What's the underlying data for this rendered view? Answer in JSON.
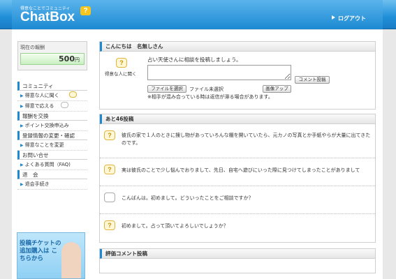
{
  "header": {
    "tagline": "得意なことでコミュニティ",
    "logo": "ChatBox",
    "logo_mark": "?",
    "logout": "ログアウト"
  },
  "sidebar": {
    "reward_title": "現在の報酬",
    "reward_value": "500",
    "reward_unit": "円",
    "sections": [
      {
        "title": "コミュニティ",
        "items": [
          "得意な人に聞く",
          "得意で応える"
        ]
      },
      {
        "title": "報酬を交換",
        "items": [
          "ポイント交換申込み"
        ]
      },
      {
        "title": "登録情報の変更・確認",
        "items": [
          "得意なことを変更"
        ]
      },
      {
        "title": "お問い合せ",
        "items": [
          "よくある質問（FAQ)"
        ]
      },
      {
        "title": "退　会",
        "items": [
          "退会手続き"
        ]
      }
    ],
    "banner_text": "投稿チケットの追加購入は こちらから"
  },
  "greeting_panel": {
    "title": "こんにちは　名無しさん",
    "icon_label": "得意な人に聞く",
    "intro": "占い天使さんに相談を投稿しましょう。",
    "textarea_value": "",
    "comment_button": "コメント投稿",
    "file_button": "ファイルを選択",
    "no_file": "ファイル未選択",
    "image_up_button": "画像アップ",
    "note": "※相手が混み合っている時は返信が滞る場合があります。"
  },
  "posts_panel": {
    "title": "あと46投稿",
    "posts": [
      {
        "type": "question",
        "text": "彼氏の家で１人のときに捜し物があっていろんな棚を開いていたら、元カノの写真とか手紙やらが大量に出てきたのです。"
      },
      {
        "type": "question",
        "text": "実は彼氏のことで少し悩んでおりまして、先日、自宅へ遊びにいった際に見つけてしまったことがありまして"
      },
      {
        "type": "comment",
        "text": "こんばんは。初めまして。どういったことをご相談ですか？"
      },
      {
        "type": "question",
        "text": "初めまして。占って頂いてよろしいでしょうか？"
      }
    ]
  },
  "eval_panel": {
    "title": "評価コメント投稿"
  }
}
